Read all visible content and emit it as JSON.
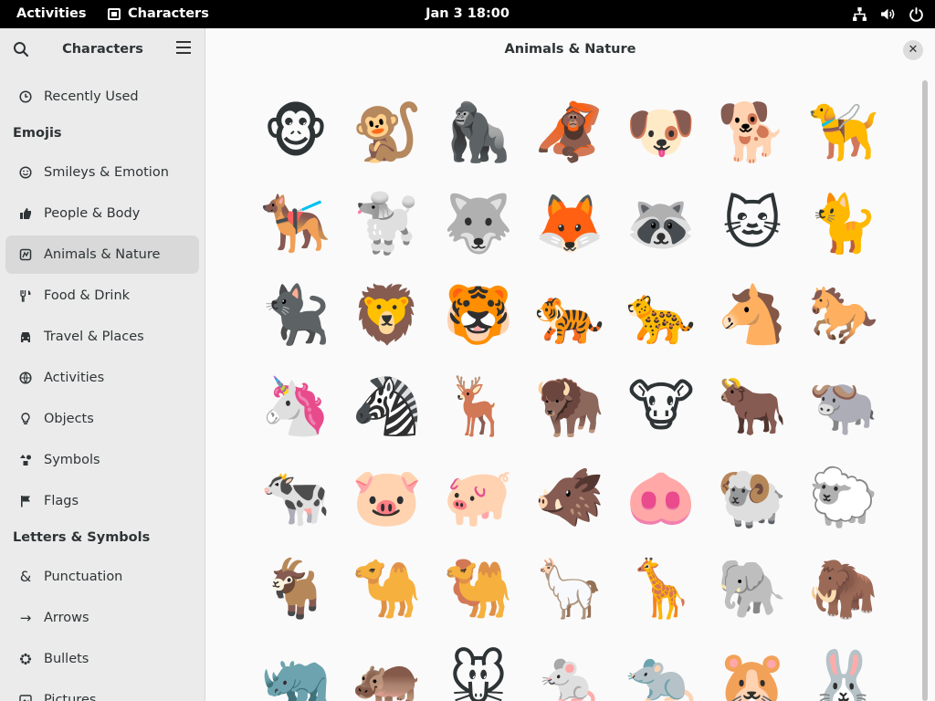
{
  "topbar": {
    "activities": "Activities",
    "app_name": "Characters",
    "clock": "Jan 3  18:00"
  },
  "header": {
    "sidebar_title": "Characters",
    "main_title": "Animals & Nature",
    "close_glyph": "✕"
  },
  "sidebar": {
    "recently_used": {
      "label": "Recently Used",
      "icon": "clock-icon"
    },
    "emojis_heading": "Emojis",
    "emoji_categories": [
      {
        "label": "Smileys & Emotion",
        "icon": "smiley-icon"
      },
      {
        "label": "People & Body",
        "icon": "thumbs-up-icon"
      },
      {
        "label": "Animals & Nature",
        "icon": "animal-icon",
        "selected": true
      },
      {
        "label": "Food & Drink",
        "icon": "utensils-icon"
      },
      {
        "label": "Travel & Places",
        "icon": "car-icon"
      },
      {
        "label": "Activities",
        "icon": "ball-icon"
      },
      {
        "label": "Objects",
        "icon": "lightbulb-icon"
      },
      {
        "label": "Symbols",
        "icon": "shapes-icon"
      },
      {
        "label": "Flags",
        "icon": "flag-icon"
      }
    ],
    "letters_heading": "Letters & Symbols",
    "letter_categories": [
      {
        "label": "Punctuation",
        "icon": "ampersand-icon"
      },
      {
        "label": "Arrows",
        "icon": "arrow-icon"
      },
      {
        "label": "Bullets",
        "icon": "bullet-icon"
      },
      {
        "label": "Pictures",
        "icon": "picture-icon"
      }
    ]
  },
  "emojis": [
    [
      "🐵",
      "🐒",
      "🦍",
      "🦧",
      "🐶",
      "🐕",
      "🦮"
    ],
    [
      "🐕‍🦺",
      "🐩",
      "🐺",
      "🦊",
      "🦝",
      "🐱",
      "🐈"
    ],
    [
      "🐈‍⬛",
      "🦁",
      "🐯",
      "🐅",
      "🐆",
      "🐴",
      "🐎"
    ],
    [
      "🦄",
      "🦓",
      "🦌",
      "🦬",
      "🐮",
      "🐂",
      "🐃"
    ],
    [
      "🐄",
      "🐷",
      "🐖",
      "🐗",
      "🐽",
      "🐏",
      "🐑"
    ],
    [
      "🐐",
      "🐪",
      "🐫",
      "🦙",
      "🦒",
      "🐘",
      "🦣"
    ],
    [
      "🦏",
      "🦛",
      "🐭",
      "🐁",
      "🐀",
      "🐹",
      "🐰"
    ]
  ]
}
